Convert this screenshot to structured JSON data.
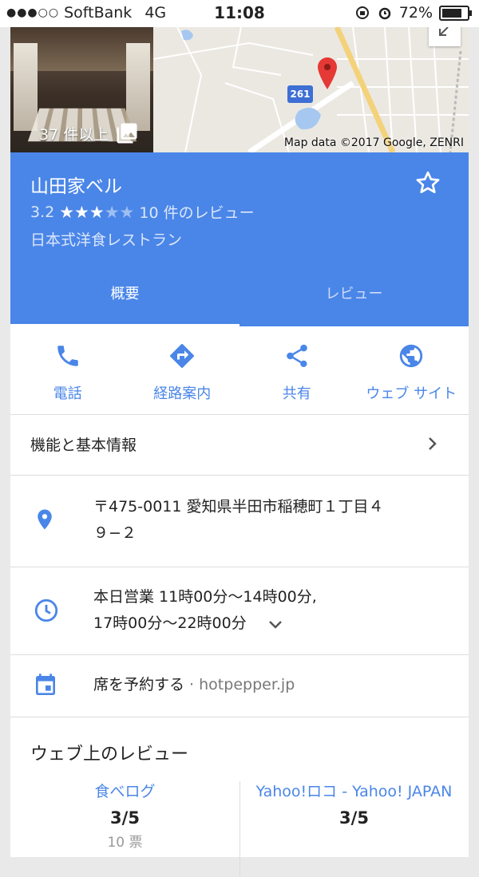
{
  "status_bar": {
    "carrier": "SoftBank",
    "network": "4G",
    "time": "11:08",
    "battery": "72%"
  },
  "hero": {
    "photo_count": "37 件以上",
    "map_credit": "Map data ©2017 Google, ZENRI",
    "route_number": "261"
  },
  "place": {
    "name": "山田家ベル",
    "rating": "3.2",
    "stars_filled": 3,
    "stars_total": 5,
    "review_count": "10 件のレビュー",
    "category": "日本式洋食レストラン"
  },
  "tabs": [
    {
      "label": "概要",
      "active": true
    },
    {
      "label": "レビュー",
      "active": false
    }
  ],
  "actions": [
    {
      "label": "電話",
      "icon": "phone-icon"
    },
    {
      "label": "経路案内",
      "icon": "directions-icon"
    },
    {
      "label": "共有",
      "icon": "share-icon"
    },
    {
      "label": "ウェブ サイト",
      "icon": "globe-icon"
    }
  ],
  "info": {
    "features": "機能と基本情報",
    "address_line1": "〒475-0011 愛知県半田市稲穂町１丁目４",
    "address_line2": "９−２",
    "hours_line1": "本日営業 11時00分～14時00分,",
    "hours_line2": "17時00分～22時00分",
    "reserve_label": "席を予約する",
    "reserve_sep": " · ",
    "reserve_site": "hotpepper.jp"
  },
  "web_reviews": {
    "title": "ウェブ上のレビュー",
    "items": [
      {
        "source": "食べログ",
        "score": "3/5",
        "count": "10 票"
      },
      {
        "source": "Yahoo!ロコ - Yahoo! JAPAN",
        "score": "3/5"
      }
    ]
  },
  "colors": {
    "accent": "#4a86e8",
    "pin": "#e53935"
  }
}
